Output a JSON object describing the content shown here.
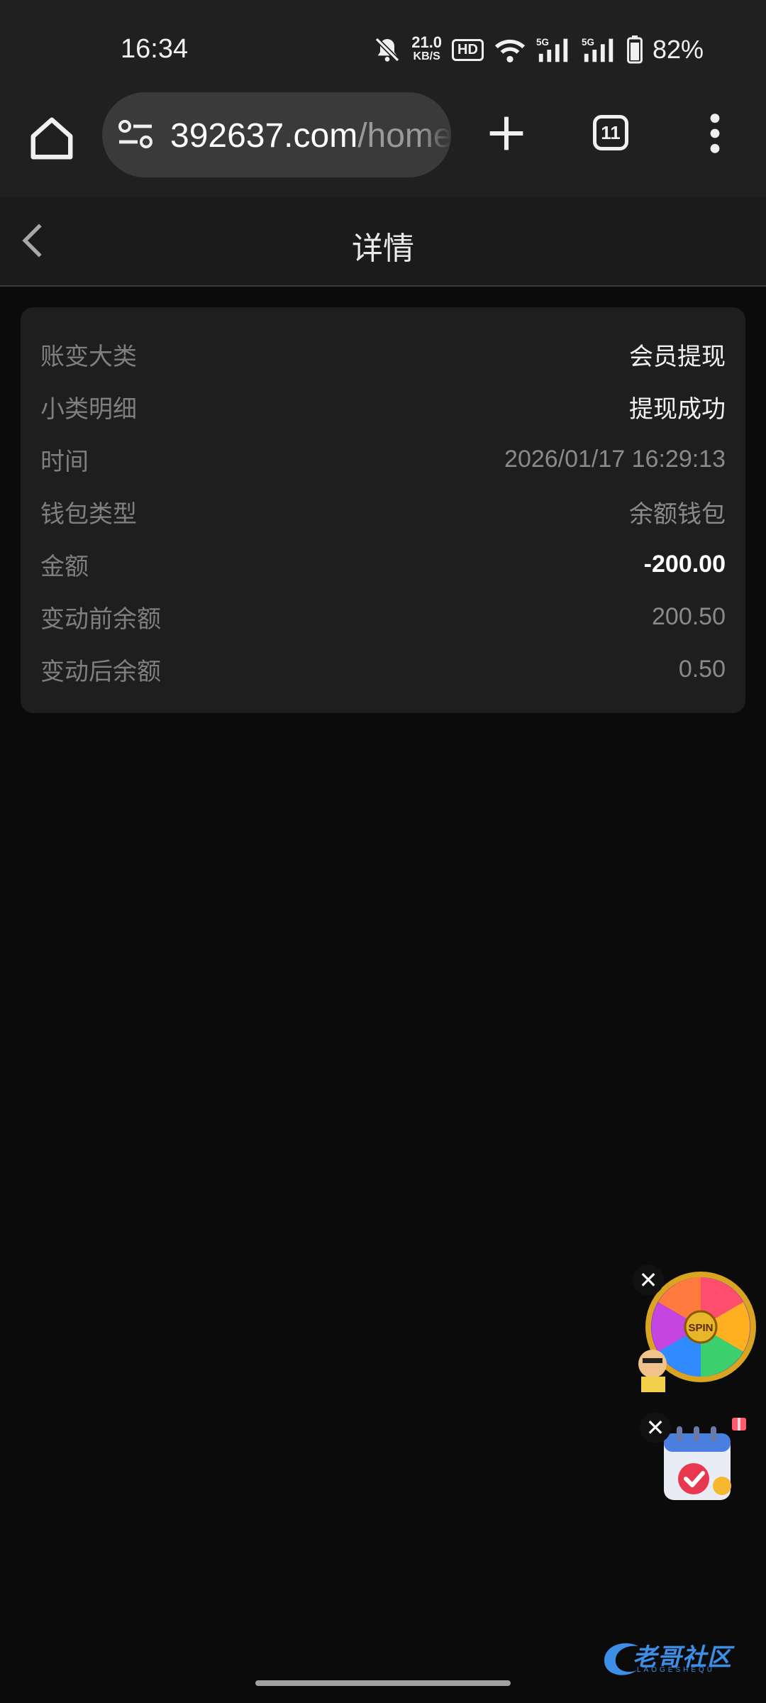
{
  "status_bar": {
    "time": "16:34",
    "net_speed_value": "21.0",
    "net_speed_unit": "KB/S",
    "hd_badge": "HD",
    "battery_percent": "82%"
  },
  "browser": {
    "url_domain": "392637.com",
    "url_path": "/home",
    "tab_count": "11"
  },
  "header": {
    "title": "详情"
  },
  "details": [
    {
      "label": "账变大类",
      "value": "会员提现"
    },
    {
      "label": "小类明细",
      "value": "提现成功"
    },
    {
      "label": "时间",
      "value": "2026/01/17 16:29:13"
    },
    {
      "label": "钱包类型",
      "value": "余额钱包"
    },
    {
      "label": "金额",
      "value": "-200.00"
    },
    {
      "label": "变动前余额",
      "value": "200.50"
    },
    {
      "label": "变动后余额",
      "value": "0.50"
    }
  ],
  "widgets": {
    "spin_label": "SPIN",
    "close_symbol": "✕"
  },
  "watermark": {
    "text": "老哥社区",
    "sub": "LAOGESHEQU"
  },
  "icons": [
    "home-icon",
    "site-settings-icon",
    "plus-icon",
    "tabs-icon",
    "more-vert-icon",
    "chevron-left-icon",
    "bell-off-icon",
    "wifi-icon",
    "signal-icon",
    "battery-icon"
  ]
}
